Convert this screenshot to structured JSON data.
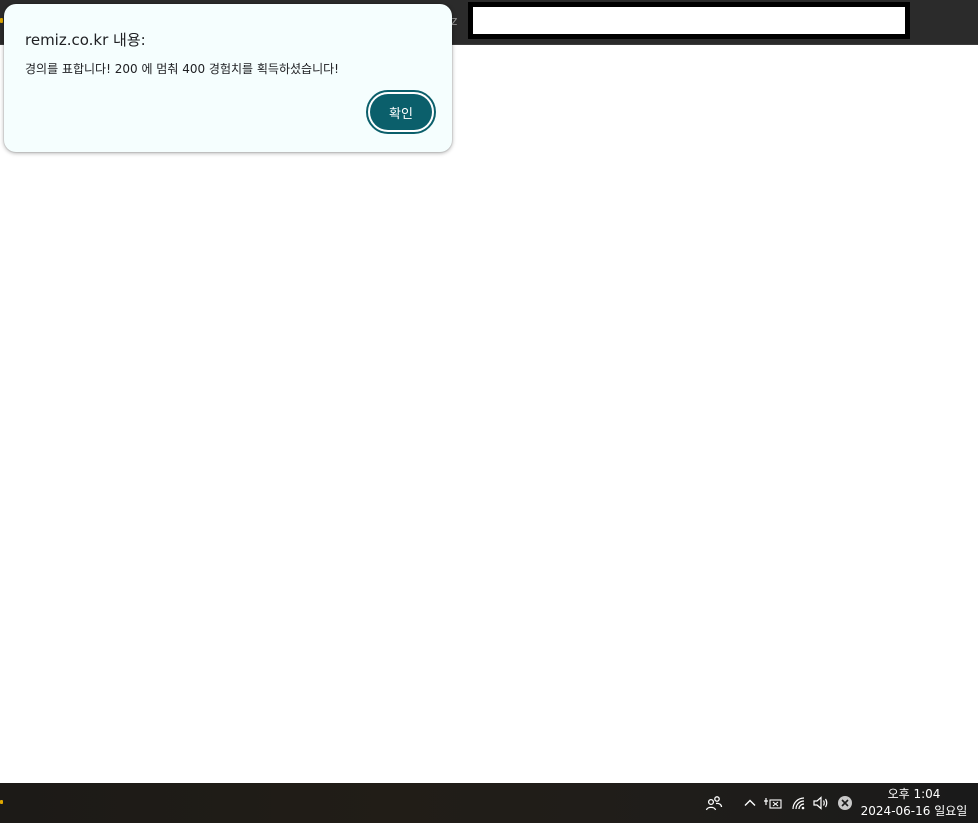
{
  "browser": {
    "tab_fragment": "z"
  },
  "dialog": {
    "title": "remiz.co.kr 내용:",
    "message": "경의를 표합니다! 200 에 멈춰 400 경험치를 획득하셨습니다!",
    "ok_label": "확인",
    "accent_color": "#0b5f6b"
  },
  "taskbar": {
    "tray_icons": [
      "people-icon",
      "chevron-up-icon",
      "keyboard-ime-icon",
      "wifi-icon",
      "speaker-icon",
      "close-circle-icon"
    ],
    "clock_time": "오후 1:04",
    "clock_date": "2024-06-16 일요일"
  }
}
